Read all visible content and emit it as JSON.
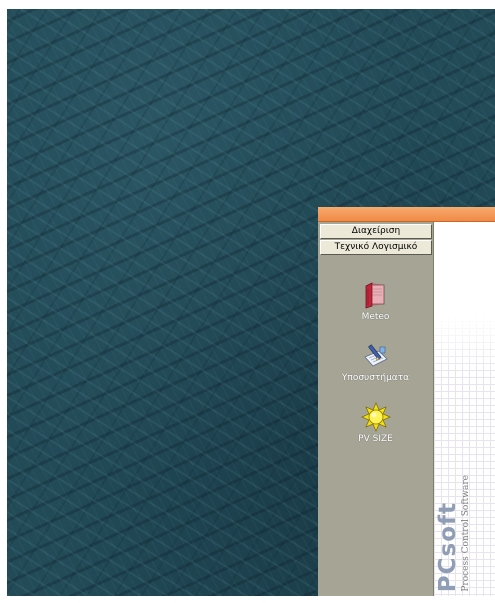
{
  "sidebar": {
    "groups": [
      "Διαχείριση",
      "Τεχνικό Λογισμικό"
    ],
    "items": [
      {
        "label": "Meteo",
        "icon": "red-book-icon"
      },
      {
        "label": "Υποσυστήματα",
        "icon": "notepad-pen-icon"
      },
      {
        "label": "PV SIZE",
        "icon": "sun-icon"
      }
    ]
  },
  "branding": {
    "logo": "PCsoft",
    "tagline": "Process Control Software"
  },
  "colors": {
    "title_strip": "#f08a46",
    "sidebar_bg": "#a5a495",
    "desktop_bg": "#224a57",
    "logo": "#8f9db5"
  }
}
